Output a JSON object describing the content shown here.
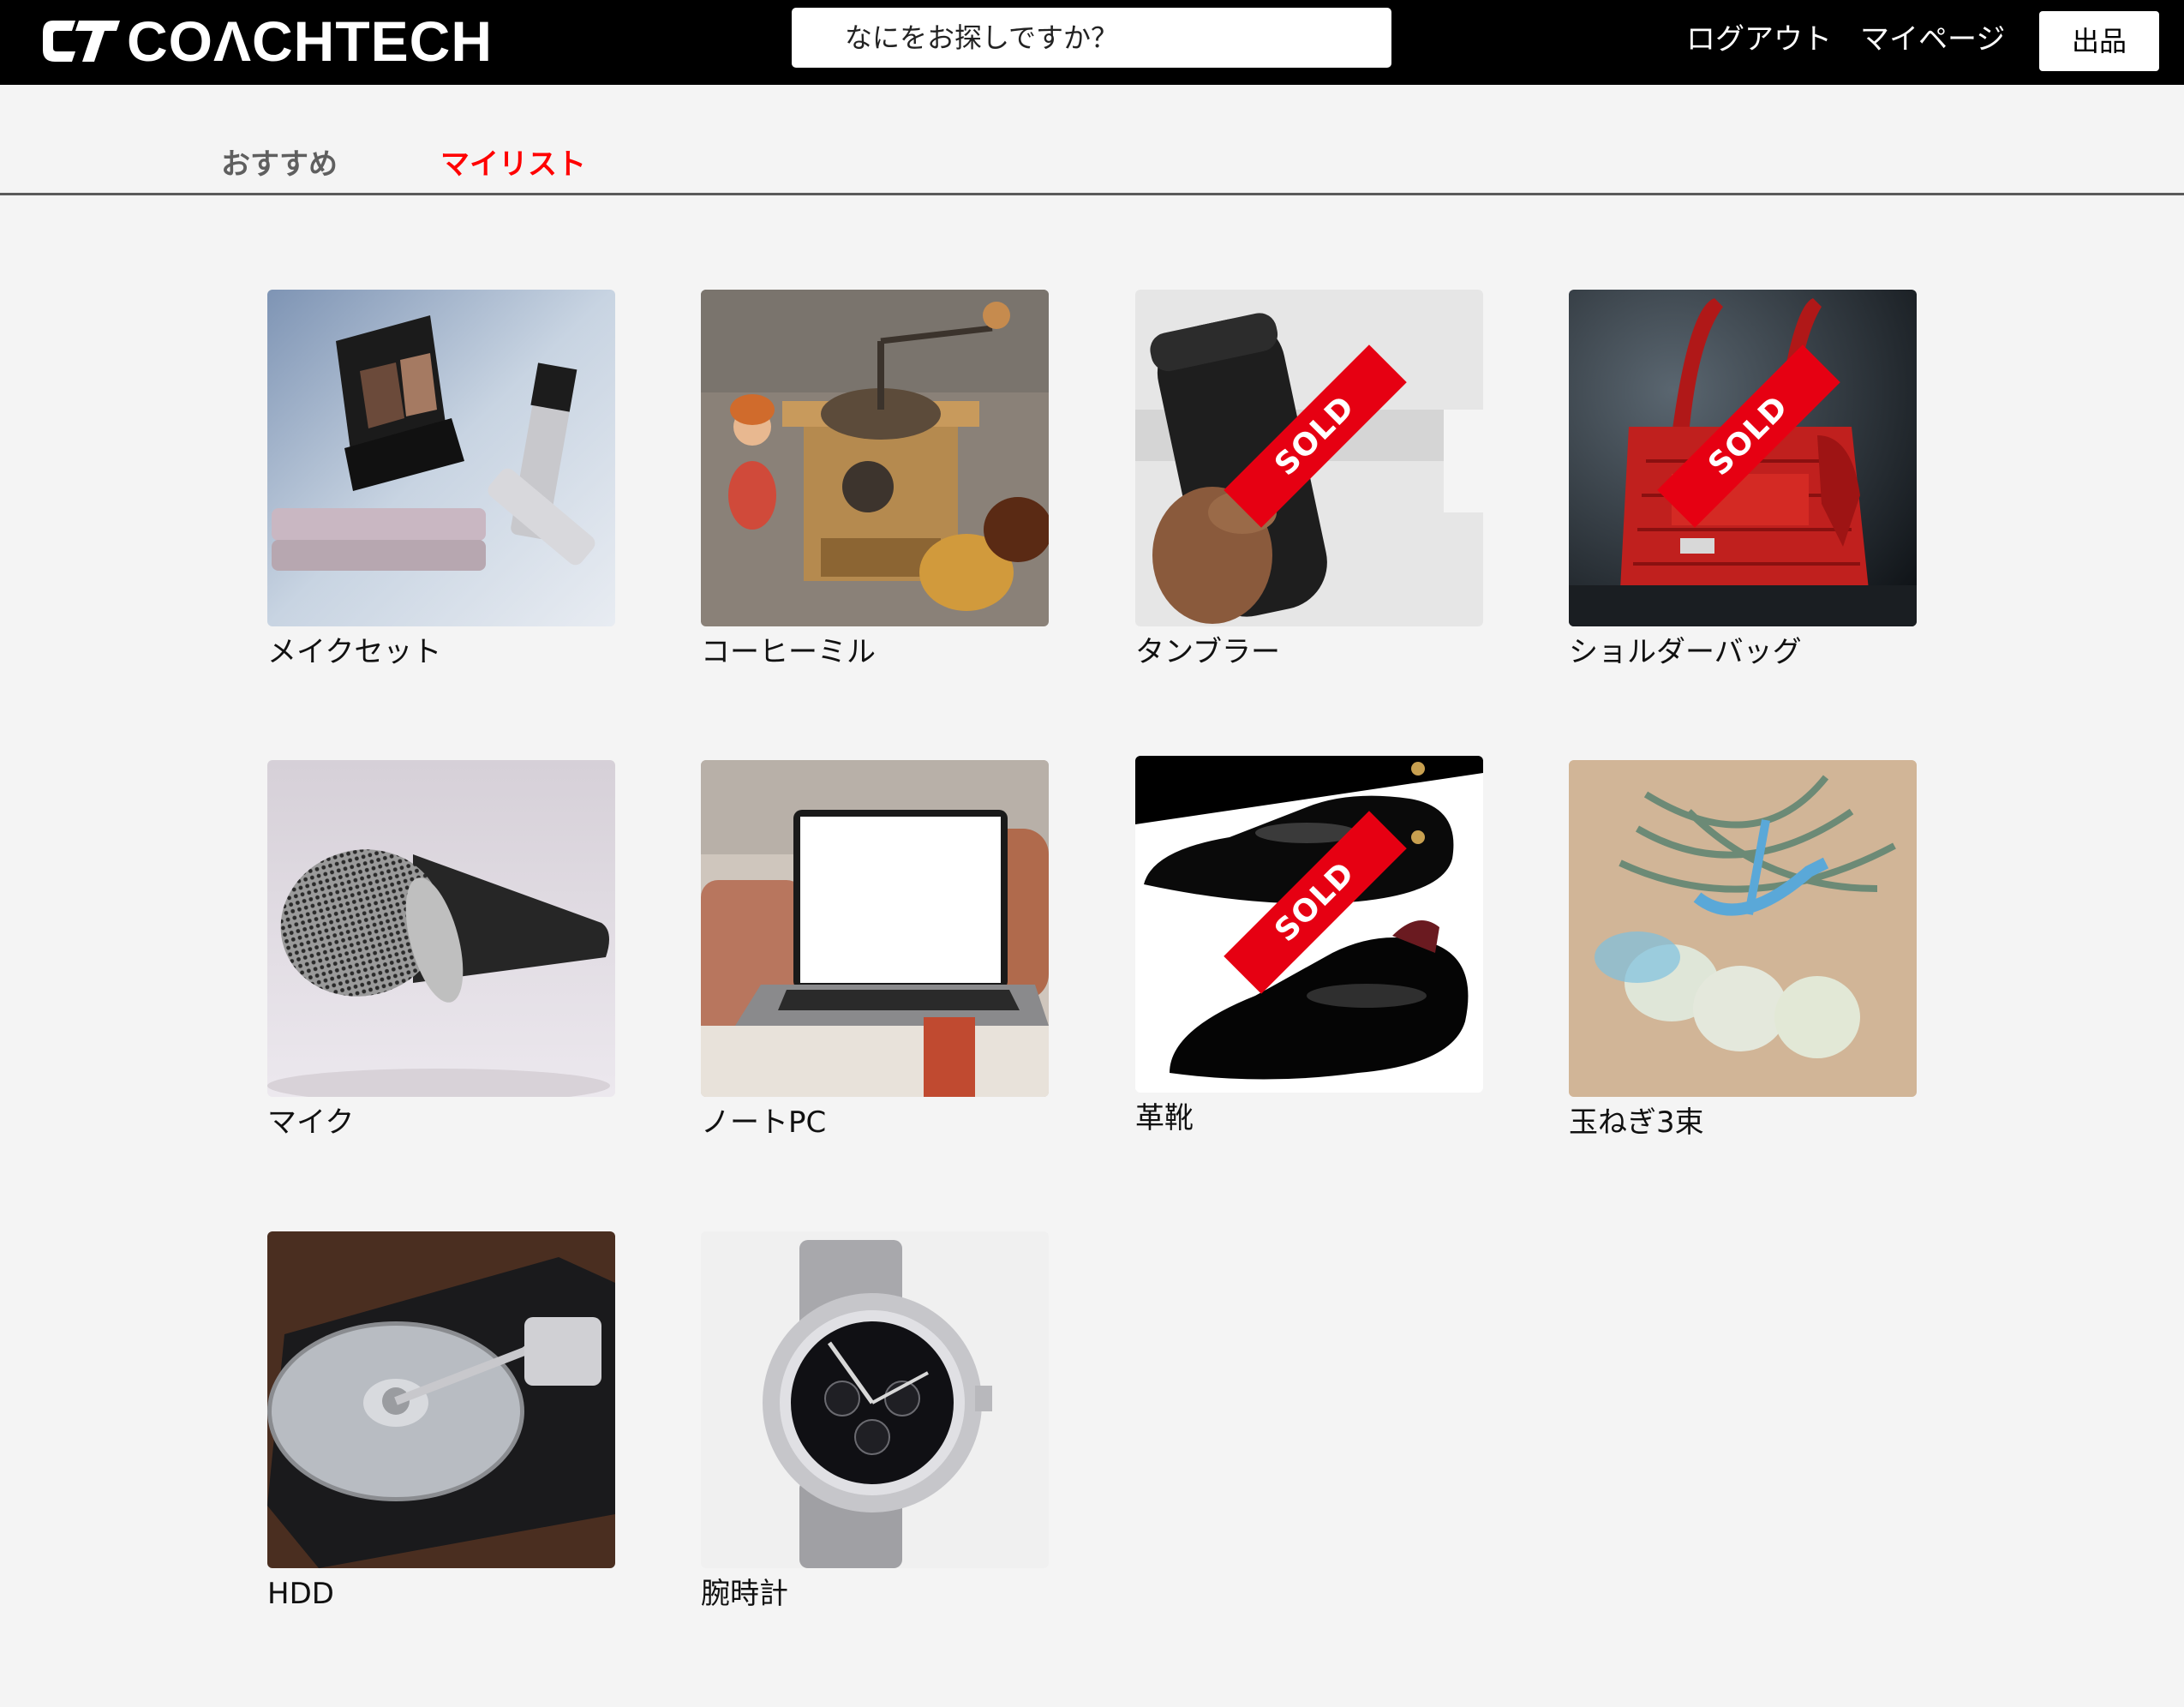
{
  "header": {
    "logo_text": "COΛCHTECH",
    "search_placeholder": "なにをお探しですか？",
    "logout_label": "ログアウト",
    "mypage_label": "マイページ",
    "sell_label": "出品"
  },
  "tabs": {
    "recommend_label": "おすすめ",
    "mylist_label": "マイリスト",
    "active": "マイリスト"
  },
  "colors": {
    "header_bg": "#000000",
    "active_tab": "#ff0000",
    "sold_badge": "#e60012",
    "page_bg": "#f4f4f4"
  },
  "sold_label": "SOLD",
  "items": [
    {
      "name": "メイクセット",
      "sold": false,
      "image": "makeup-set"
    },
    {
      "name": "コーヒーミル",
      "sold": false,
      "image": "coffee-mill"
    },
    {
      "name": "タンブラー",
      "sold": true,
      "image": "tumbler"
    },
    {
      "name": "ショルダーバッグ",
      "sold": true,
      "image": "shoulder-bag"
    },
    {
      "name": "マイク",
      "sold": false,
      "image": "microphone"
    },
    {
      "name": "ノートPC",
      "sold": false,
      "image": "laptop"
    },
    {
      "name": "革靴",
      "sold": true,
      "image": "leather-shoes"
    },
    {
      "name": "玉ねぎ3束",
      "sold": false,
      "image": "onions"
    },
    {
      "name": "HDD",
      "sold": false,
      "image": "hdd"
    },
    {
      "name": "腕時計",
      "sold": false,
      "image": "wristwatch"
    }
  ]
}
